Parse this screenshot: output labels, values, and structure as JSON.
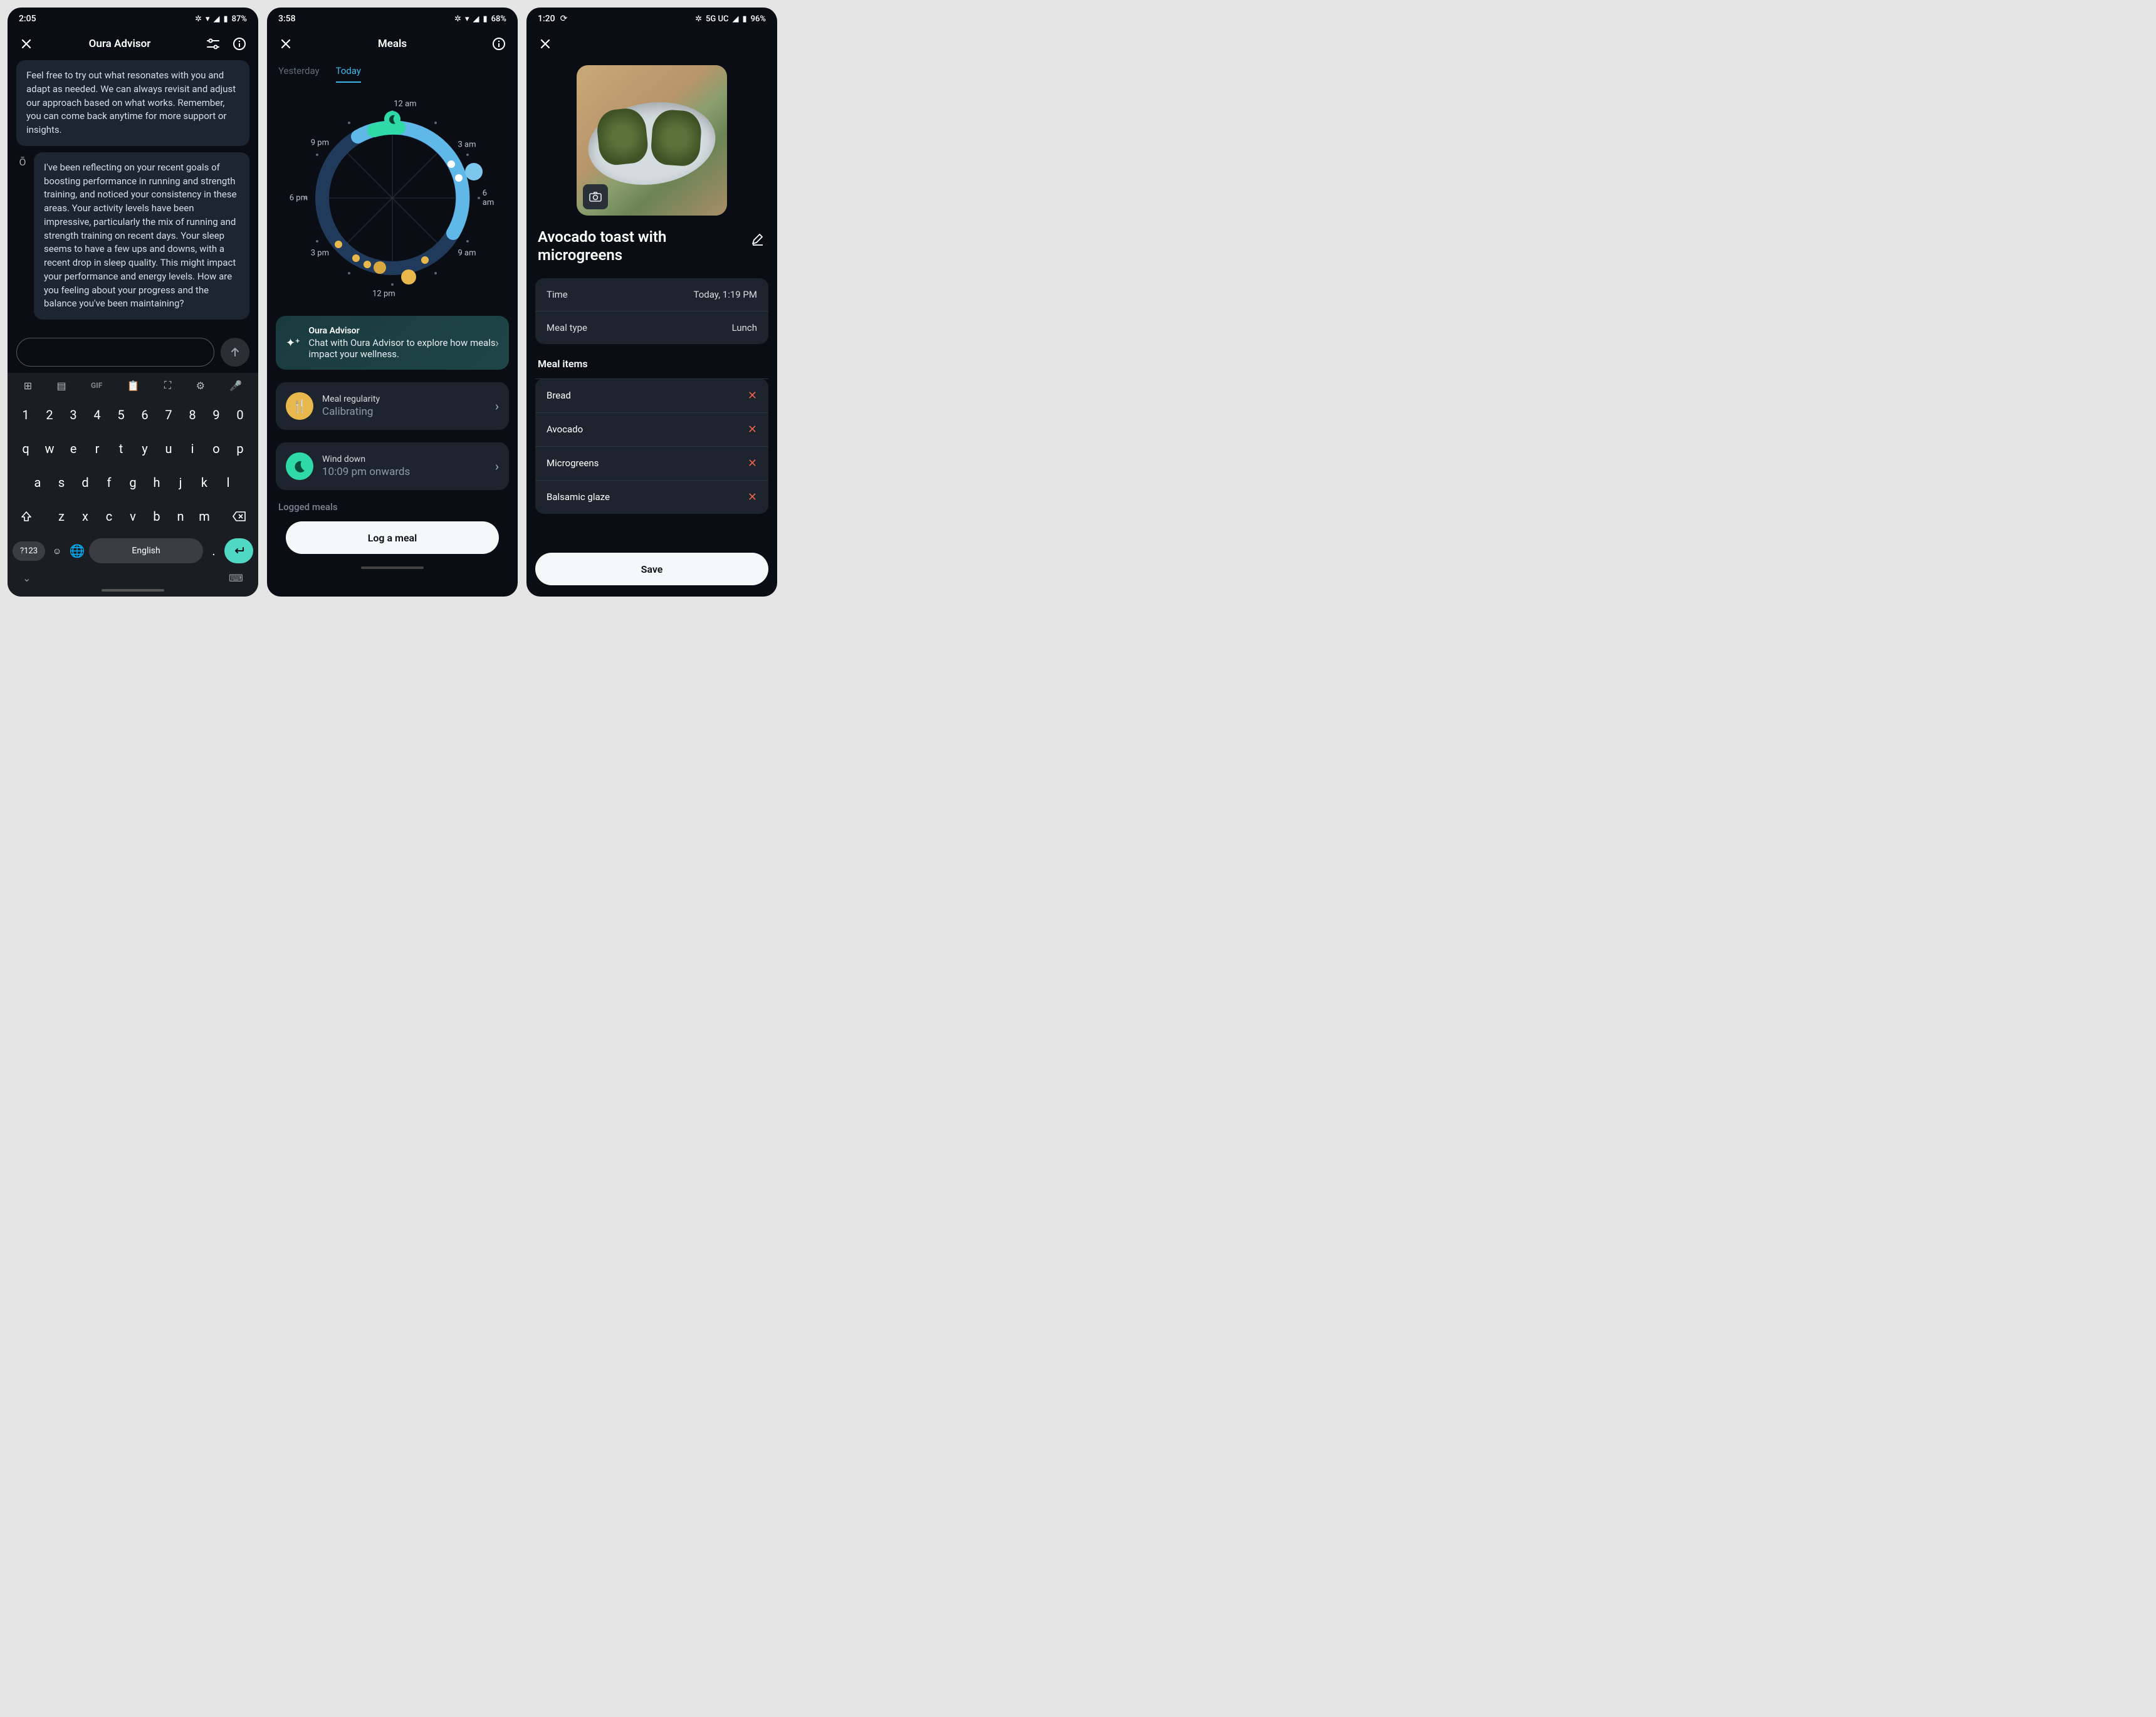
{
  "panel1": {
    "status": {
      "time": "2:05",
      "battery": "87%"
    },
    "title": "Oura Advisor",
    "msg1": "Feel free to try out what resonates with you and adapt as needed. We can always revisit and adjust our approach based on what works. Remember, you can come back anytime for more support or insights.",
    "msg2": "I've been reflecting on your recent goals of boosting performance in running and strength training, and noticed your consistency in these areas. Your activity levels have been impressive, particularly the mix of running and strength training on recent days. Your sleep seems to have a few ups and downs, with a recent drop in sleep quality. This might impact your performance and energy levels. How are you feeling about your progress and the balance you've been maintaining?",
    "keyboard": {
      "row_num": [
        "1",
        "2",
        "3",
        "4",
        "5",
        "6",
        "7",
        "8",
        "9",
        "0"
      ],
      "row1": [
        "q",
        "w",
        "e",
        "r",
        "t",
        "y",
        "u",
        "i",
        "o",
        "p"
      ],
      "row2": [
        "a",
        "s",
        "d",
        "f",
        "g",
        "h",
        "j",
        "k",
        "l"
      ],
      "row3": [
        "z",
        "x",
        "c",
        "v",
        "b",
        "n",
        "m"
      ],
      "sym": "?123",
      "space": "English",
      "gif": "GIF"
    }
  },
  "panel2": {
    "status": {
      "time": "3:58",
      "battery": "68%"
    },
    "title": "Meals",
    "tabs": {
      "yesterday": "Yesterday",
      "today": "Today"
    },
    "clock_labels": {
      "t12a": "12 am",
      "t3a": "3 am",
      "t6a": "6 am",
      "t9a": "9 am",
      "t12p": "12 pm",
      "t3p": "3 pm",
      "t6p": "6 pm",
      "t9p": "9 pm"
    },
    "advisor": {
      "title": "Oura Advisor",
      "sub": "Chat with Oura Advisor to explore how meals impact your wellness."
    },
    "regularity": {
      "title": "Meal regularity",
      "sub": "Calibrating"
    },
    "wind": {
      "title": "Wind down",
      "sub": "10:09 pm onwards"
    },
    "logged_label": "Logged meals",
    "log_btn": "Log a meal"
  },
  "panel3": {
    "status": {
      "time": "1:20",
      "net": "5G UC",
      "battery": "96%"
    },
    "title": "Avocado toast with microgreens",
    "time_row": {
      "label": "Time",
      "value": "Today, 1:19 PM"
    },
    "type_row": {
      "label": "Meal type",
      "value": "Lunch"
    },
    "items_header": "Meal items",
    "items": [
      "Bread",
      "Avocado",
      "Microgreens",
      "Balsamic glaze"
    ],
    "save": "Save"
  }
}
